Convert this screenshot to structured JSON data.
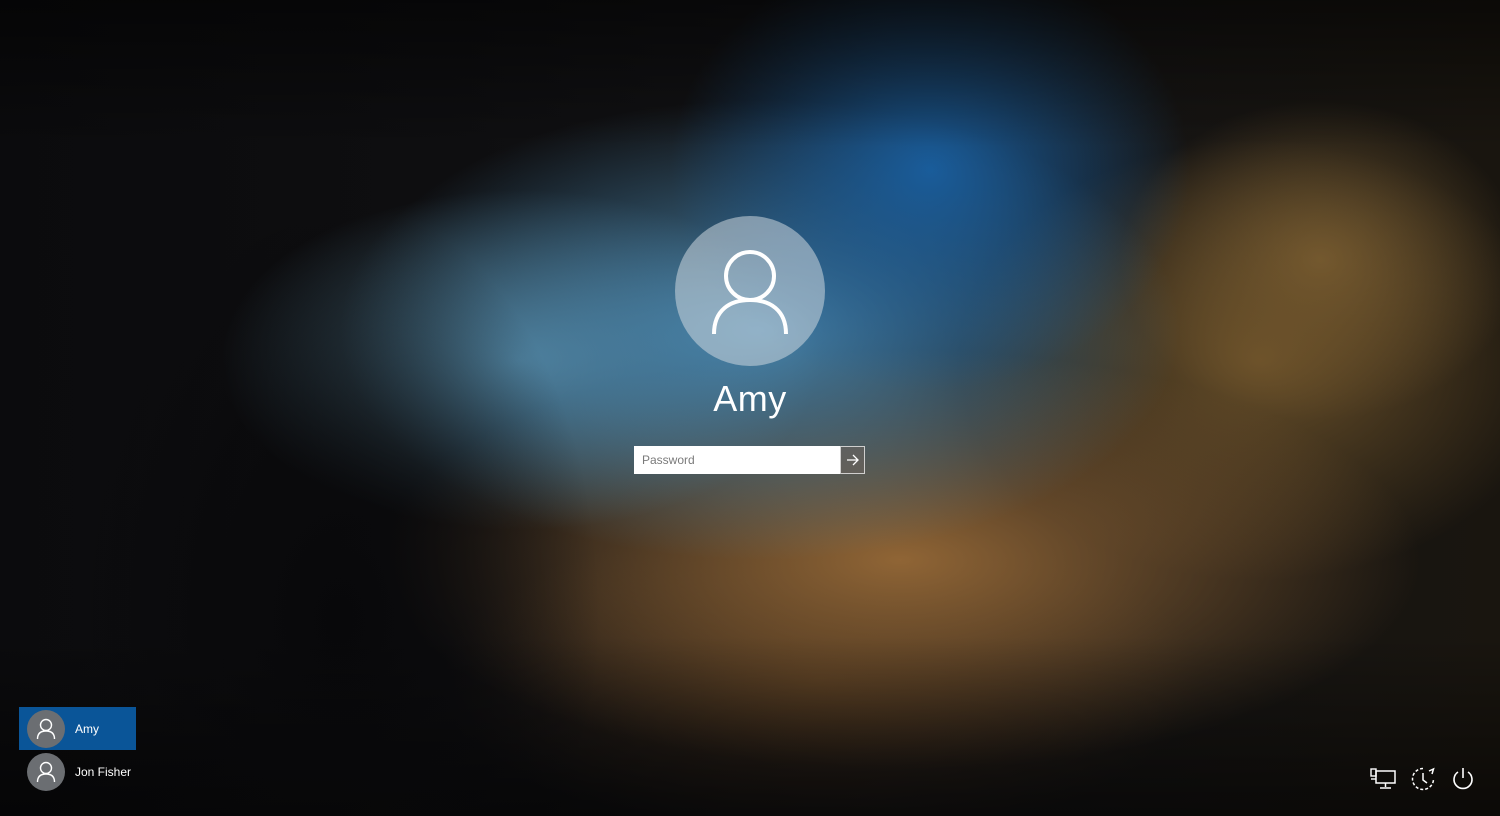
{
  "signin": {
    "username": "Amy",
    "password_placeholder": "Password",
    "submit_icon": "arrow-right-icon"
  },
  "user_list": [
    {
      "name": "Amy",
      "selected": true,
      "icon": "user-icon"
    },
    {
      "name": "Jon Fisher",
      "selected": false,
      "icon": "user-icon"
    }
  ],
  "system_buttons": [
    {
      "icon": "network-icon"
    },
    {
      "icon": "accessibility-icon"
    },
    {
      "icon": "power-icon"
    }
  ],
  "colors": {
    "selected_user_bg": "#0a5598",
    "text": "#ffffff",
    "avatar_bg": "#6b6e72"
  }
}
